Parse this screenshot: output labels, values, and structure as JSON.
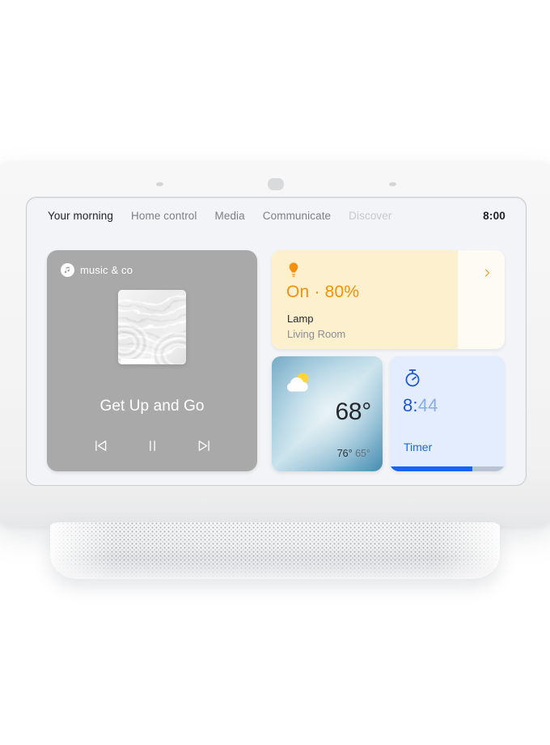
{
  "device": {
    "name": "smart-display",
    "sensors": [
      "ambient-light-sensor",
      "camera",
      "ambient-light-sensor"
    ]
  },
  "navbar": {
    "items": [
      {
        "label": "Your morning",
        "state": "active"
      },
      {
        "label": "Home control",
        "state": "normal"
      },
      {
        "label": "Media",
        "state": "normal"
      },
      {
        "label": "Communicate",
        "state": "normal"
      },
      {
        "label": "Discover",
        "state": "dimmed"
      }
    ],
    "clock": "8:00"
  },
  "music_card": {
    "provider": "music & co",
    "provider_icon": "music-note-icon",
    "track_title": "Get Up and Go",
    "album_art": "water-ripple-artwork",
    "controls": [
      {
        "name": "previous-track",
        "icon": "skip-previous-icon"
      },
      {
        "name": "play-pause",
        "icon": "pause-icon"
      },
      {
        "name": "next-track",
        "icon": "skip-next-icon"
      }
    ],
    "background_color": "#a9a9a9"
  },
  "lamp_card": {
    "icon": "light-bulb-icon",
    "state": "On · 80%",
    "brightness_percent": 80,
    "name": "Lamp",
    "room": "Living Room",
    "chevron_icon": "chevron-right-icon",
    "accent_color": "#f3900c",
    "fill_color": "#fdf0cf",
    "background_color": "#fdfbf3"
  },
  "weather_card": {
    "icon": "partly-cloudy-icon",
    "temperature": "68°",
    "high": "76°",
    "low": "65°"
  },
  "timer_card": {
    "icon": "stopwatch-icon",
    "time_elapsed": "8:",
    "time_remaining": "44",
    "label": "Timer",
    "progress_percent": 72,
    "accent_color": "#1565f0",
    "background_color": "#e3edfd"
  }
}
